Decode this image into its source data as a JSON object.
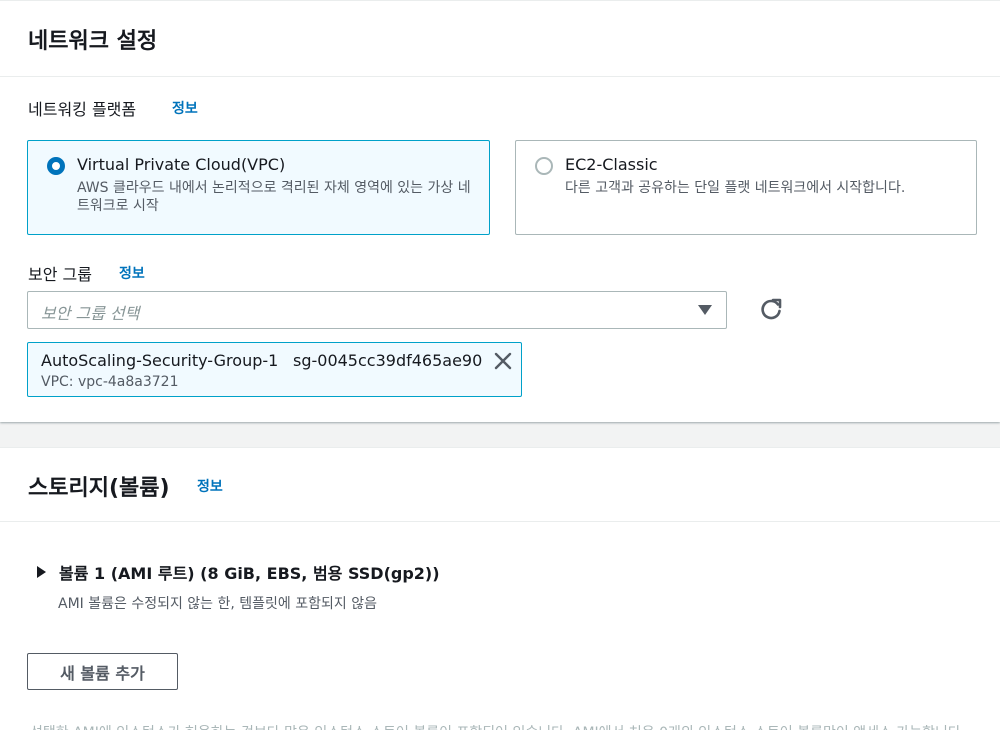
{
  "network": {
    "title": "네트워크 설정",
    "platform_label": "네트워킹 플랫폼",
    "info": "정보",
    "options": [
      {
        "title": "Virtual Private Cloud(VPC)",
        "description": "AWS 클라우드 내에서 논리적으로 격리된 자체 영역에 있는 가상 네트워크로 시작",
        "selected": true
      },
      {
        "title": "EC2-Classic",
        "description": "다른 고객과 공유하는 단일 플랫 네트워크에서 시작합니다.",
        "selected": false
      }
    ],
    "security_group": {
      "label": "보안 그룹",
      "info": "정보",
      "placeholder": "보안 그룹 선택",
      "token": {
        "name": "AutoScaling-Security-Group-1",
        "id": "sg-0045cc39df465ae90",
        "vpc": "VPC: vpc-4a8a3721"
      }
    }
  },
  "storage": {
    "title": "스토리지(볼륨)",
    "info": "정보",
    "volume_title": "볼륨 1 (AMI 루트) (8 GiB, EBS, 범용 SSD(gp2))",
    "volume_desc": "AMI 볼륨은 수정되지 않는 한, 템플릿에 포함되지 않음",
    "add_button": "새 볼륨 추가",
    "footnote": "선택한 AMI에 인스턴스가 허용하는 것보다 많은 인스턴스 스토어 볼륨이 포함되어 있습니다. AMI에서 처음 0개의 인스턴스 스토어 볼륨만이 액세스 가능합니다."
  },
  "colors": {
    "accent": "#0073bb",
    "selected_border": "#00a1c9",
    "selected_bg": "#f1faff"
  }
}
